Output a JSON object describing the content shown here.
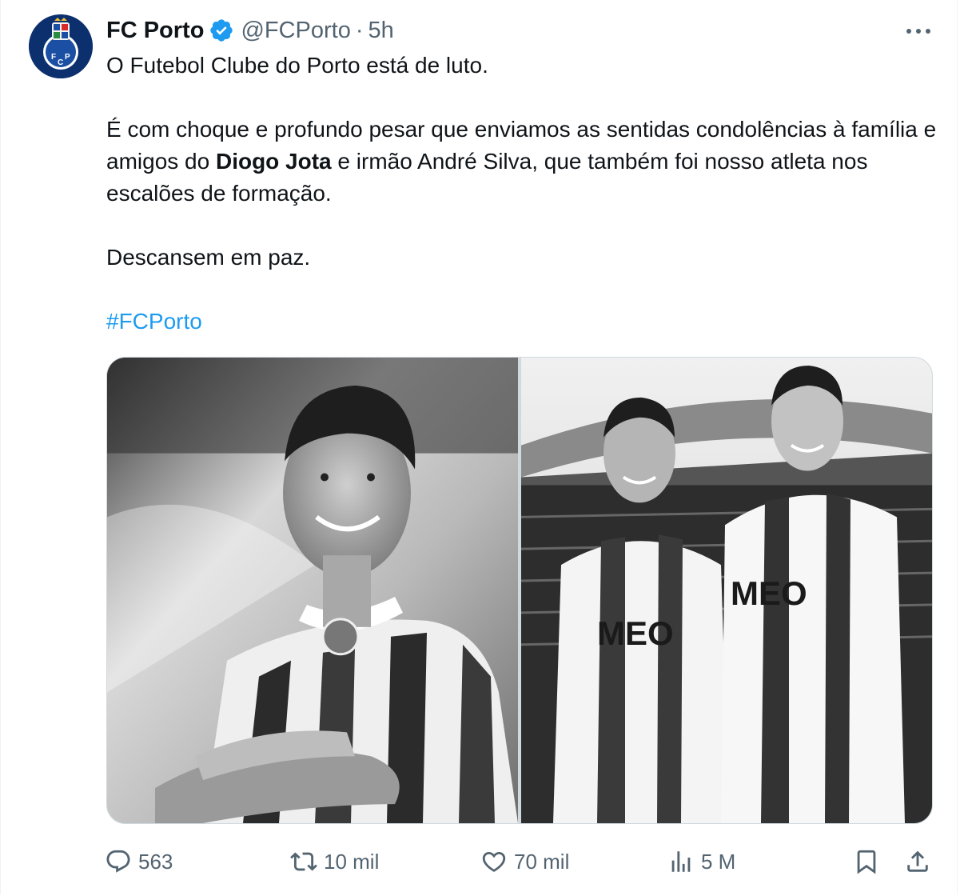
{
  "author": {
    "name": "FC Porto",
    "handle": "@FCPorto",
    "separator": "·",
    "time": "5h",
    "verified_color": "#1d9bf0",
    "avatar_icon": "fc-porto-crest-icon"
  },
  "tweet": {
    "line1": "O Futebol Clube do Porto está de luto.",
    "p2_before": "É com choque e profundo pesar que enviamos as sentidas condolências à família e amigos do ",
    "p2_bold": "Diogo Jota",
    "p2_after": " e irmão André Silva, que também foi nosso atleta nos escalões de formação.",
    "line3": "Descansem em paz.",
    "hashtag": "#FCPorto"
  },
  "media": {
    "images": [
      {
        "name": "photo-player-portrait",
        "style": "black-and-white"
      },
      {
        "name": "photo-two-players-stadium",
        "style": "black-and-white"
      }
    ]
  },
  "actions": {
    "replies": "563",
    "reposts": "10 mil",
    "likes": "70 mil",
    "views": "5 M"
  },
  "colors": {
    "text": "#0f1419",
    "muted": "#536471",
    "link": "#1d9bf0",
    "border": "#cfd9de"
  }
}
